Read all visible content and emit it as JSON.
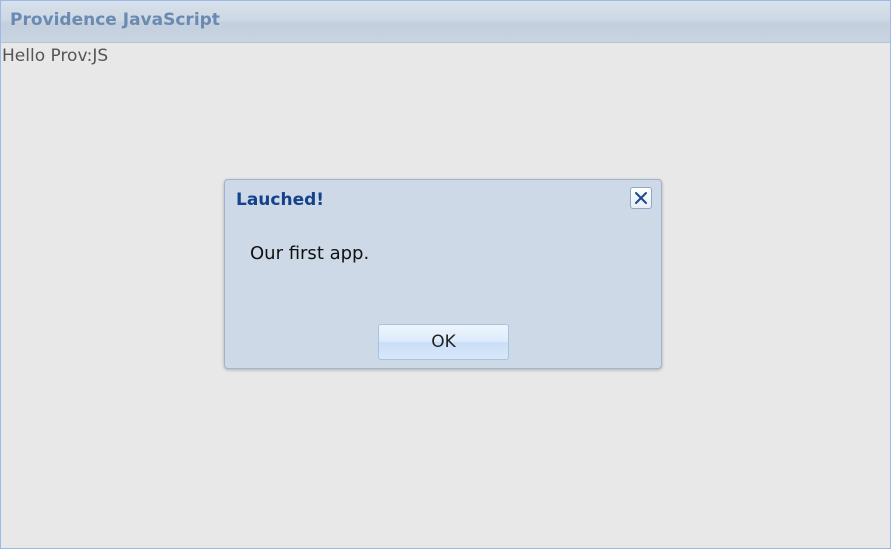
{
  "app": {
    "title": "Providence JavaScript"
  },
  "main": {
    "hello_text": "Hello Prov:JS"
  },
  "dialog": {
    "title": "Lauched!",
    "message": "Our first app.",
    "ok_label": "OK",
    "close_icon": "close-icon"
  },
  "colors": {
    "title_text": "#6a8ab2",
    "dialog_title": "#15428b",
    "dialog_bg": "#cdd9e7",
    "page_bg": "#e8e8e8"
  }
}
